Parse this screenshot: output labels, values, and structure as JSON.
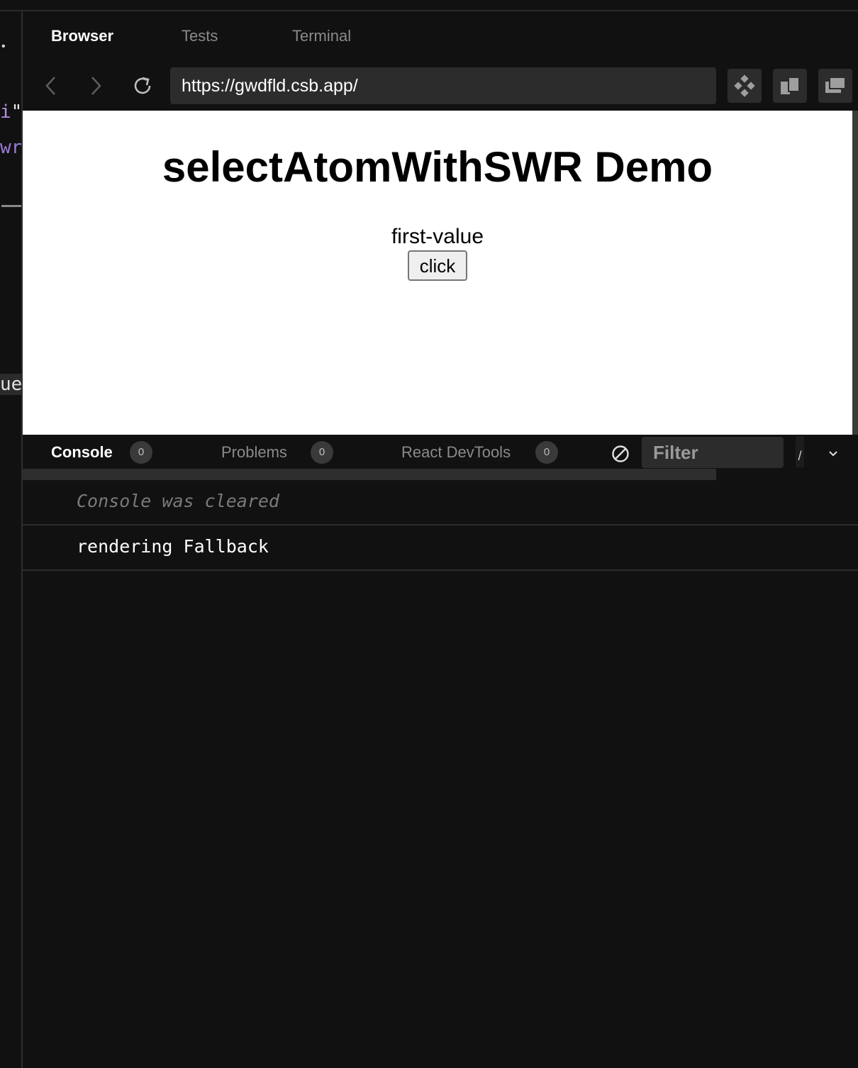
{
  "editor_fragments": {
    "bullet": "•",
    "line_1_code": "i",
    "line_1_quote": "\"",
    "line_2_code": "wr",
    "line_3_code": "ue"
  },
  "tabs": [
    {
      "label": "Browser",
      "active": true
    },
    {
      "label": "Tests",
      "active": false
    },
    {
      "label": "Terminal",
      "active": false
    }
  ],
  "navigation": {
    "url": "https://gwdfld.csb.app/"
  },
  "preview": {
    "title": "selectAtomWithSWR Demo",
    "value_text": "first-value",
    "button_label": "click"
  },
  "devtools": {
    "tabs": [
      {
        "label": "Console",
        "count": "0",
        "active": true
      },
      {
        "label": "Problems",
        "count": "0",
        "active": false
      },
      {
        "label": "React DevTools",
        "count": "0",
        "active": false
      }
    ],
    "filter_placeholder": "Filter",
    "extra_glyph": "/"
  },
  "console": {
    "messages": [
      {
        "text": "Console was cleared",
        "kind": "info"
      },
      {
        "text": "rendering Fallback",
        "kind": "log"
      }
    ]
  },
  "colors": {
    "background": "#111111",
    "panel": "#2c2c2c",
    "text_primary": "#ffffff",
    "text_muted": "#8a8a8a",
    "code_purple": "#b48ee6"
  }
}
